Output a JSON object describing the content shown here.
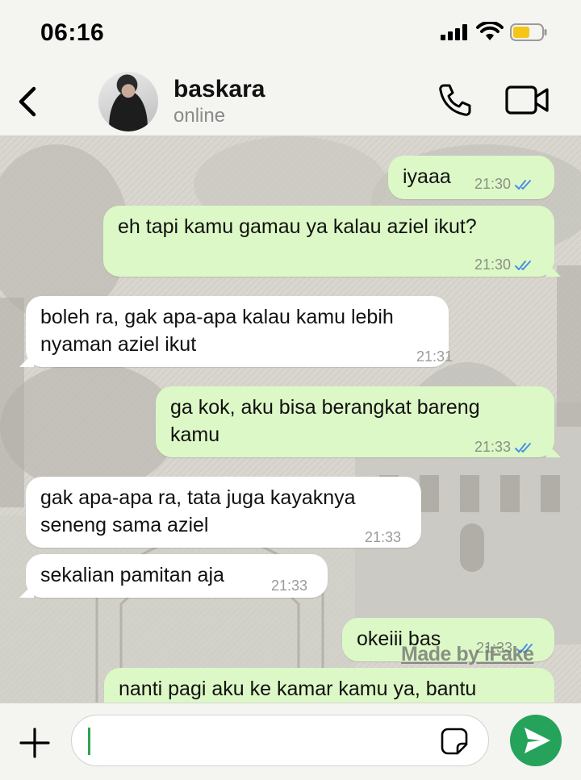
{
  "status_bar": {
    "time": "06:16"
  },
  "header": {
    "contact_name": "baskara",
    "contact_status": "online"
  },
  "icons": {
    "back": "chevron-left-icon",
    "call": "phone-icon",
    "video": "video-camera-icon",
    "plus": "plus-icon",
    "sticker": "sticker-icon",
    "send": "send-icon",
    "read_receipt": "double-check-icon"
  },
  "colors": {
    "outgoing_bubble": "#dcf8c6",
    "incoming_bubble": "#ffffff",
    "read_ticks": "#4a90e2",
    "send_button": "#25a35a"
  },
  "messages": [
    {
      "direction": "out",
      "lines": [
        "iyaaa"
      ],
      "time": "21:30",
      "read": true
    },
    {
      "direction": "out",
      "lines": [
        "eh tapi kamu gamau ya kalau aziel ikut?"
      ],
      "time": "21:30",
      "read": true
    },
    {
      "direction": "in",
      "lines": [
        "boleh ra, gak apa-apa kalau kamu lebih",
        "nyaman aziel ikut"
      ],
      "time": "21:31"
    },
    {
      "direction": "out",
      "lines": [
        "ga kok, aku bisa berangkat bareng",
        "kamu"
      ],
      "time": "21:33",
      "read": true
    },
    {
      "direction": "in",
      "lines": [
        "gak apa-apa ra, tata juga kayaknya",
        "seneng sama aziel"
      ],
      "time": "21:33"
    },
    {
      "direction": "in",
      "lines": [
        "sekalian pamitan aja"
      ],
      "time": "21:33"
    },
    {
      "direction": "out",
      "lines": [
        "okeiii bas"
      ],
      "time": "21:33",
      "read": true
    },
    {
      "direction": "out",
      "lines": [
        "nanti pagi aku ke kamar kamu ya, bantu"
      ],
      "time": "",
      "read": false
    }
  ],
  "watermark": "Made by iFake",
  "input": {
    "value": "",
    "placeholder": ""
  }
}
